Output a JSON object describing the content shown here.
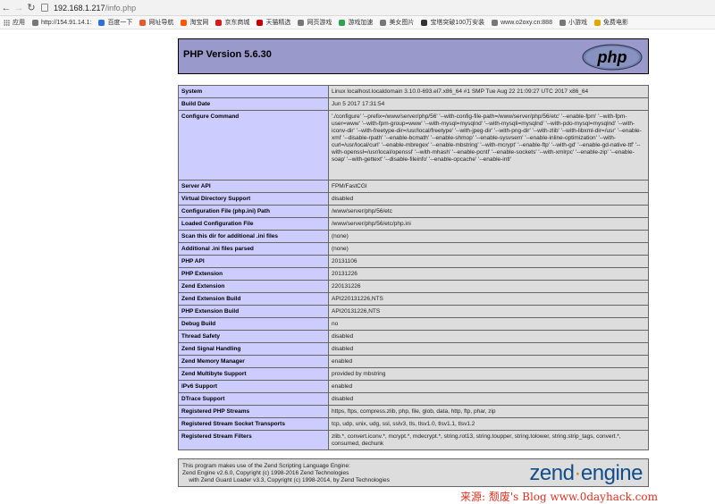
{
  "browser": {
    "url_host": "192.168.1.217",
    "url_path": "/info.php",
    "bookmarks": [
      {
        "label": "应用",
        "color": "#4a7bd6",
        "icon": "apps-icon"
      },
      {
        "label": "http://154.91.14.1:",
        "color": "#777777",
        "icon": "page-icon"
      },
      {
        "label": "百度一下",
        "color": "#2f6ee0",
        "icon": "baidu-icon"
      },
      {
        "label": "网址导航",
        "color": "#e55a2b",
        "icon": "nav-icon"
      },
      {
        "label": "淘宝网",
        "color": "#ff5500",
        "icon": "page-icon"
      },
      {
        "label": "京东商城",
        "color": "#d71a1a",
        "icon": "jd-icon"
      },
      {
        "label": "天猫精选",
        "color": "#c40000",
        "icon": "page-icon"
      },
      {
        "label": "网页游戏",
        "color": "#777777",
        "icon": "page-icon"
      },
      {
        "label": "游戏加速",
        "color": "#2da44e",
        "icon": "page-icon"
      },
      {
        "label": "美女图片",
        "color": "#777777",
        "icon": "page-icon"
      },
      {
        "label": "宝塔突破100万安装",
        "color": "#333333",
        "icon": "bt-icon"
      },
      {
        "label": "www.o2oxy.cn:888",
        "color": "#777777",
        "icon": "page-icon"
      },
      {
        "label": "小游戏",
        "color": "#777777",
        "icon": "page-icon"
      },
      {
        "label": "免费电影",
        "color": "#e0a800",
        "icon": "page-icon"
      }
    ]
  },
  "phpinfo": {
    "title": "PHP Version 5.6.30",
    "logo_text": "php",
    "rows": [
      {
        "key": "System",
        "value": "Linux localhost.localdomain 3.10.0-693.el7.x86_64 #1 SMP Tue Aug 22 21:09:27 UTC 2017 x86_64"
      },
      {
        "key": "Build Date",
        "value": "Jun 5 2017 17:31:54"
      },
      {
        "key": "Configure Command",
        "value": "'./configure' '--prefix=/www/server/php/56' '--with-config-file-path=/www/server/php/56/etc' '--enable-fpm' '--with-fpm-user=www' '--with-fpm-group=www' '--with-mysql=mysqlnd' '--with-mysqli=mysqlnd' '--with-pdo-mysql=mysqlnd' '--with-iconv-dir' '--with-freetype-dir=/usr/local/freetype' '--with-jpeg-dir' '--with-png-dir' '--with-zlib' '--with-libxml-dir=/usr' '--enable-xml' '--disable-rpath' '--enable-bcmath' '--enable-shmop' '--enable-sysvsem' '--enable-inline-optimization' '--with-curl=/usr/local/curl' '--enable-mbregex' '--enable-mbstring' '--with-mcrypt' '--enable-ftp' '--with-gd' '--enable-gd-native-ttf' '--with-openssl=/usr/local/openssl' '--with-mhash' '--enable-pcntl' '--enable-sockets' '--with-xmlrpc' '--enable-zip' '--enable-soap' '--with-gettext' '--disable-fileinfo' '--enable-opcache' '--enable-intl'"
      },
      {
        "key": "Server API",
        "value": "FPM/FastCGI"
      },
      {
        "key": "Virtual Directory Support",
        "value": "disabled"
      },
      {
        "key": "Configuration File (php.ini) Path",
        "value": "/www/server/php/56/etc"
      },
      {
        "key": "Loaded Configuration File",
        "value": "/www/server/php/56/etc/php.ini"
      },
      {
        "key": "Scan this dir for additional .ini files",
        "value": "(none)"
      },
      {
        "key": "Additional .ini files parsed",
        "value": "(none)"
      },
      {
        "key": "PHP API",
        "value": "20131106"
      },
      {
        "key": "PHP Extension",
        "value": "20131226"
      },
      {
        "key": "Zend Extension",
        "value": "220131226"
      },
      {
        "key": "Zend Extension Build",
        "value": "API220131226,NTS"
      },
      {
        "key": "PHP Extension Build",
        "value": "API20131226,NTS"
      },
      {
        "key": "Debug Build",
        "value": "no"
      },
      {
        "key": "Thread Safety",
        "value": "disabled"
      },
      {
        "key": "Zend Signal Handling",
        "value": "disabled"
      },
      {
        "key": "Zend Memory Manager",
        "value": "enabled"
      },
      {
        "key": "Zend Multibyte Support",
        "value": "provided by mbstring"
      },
      {
        "key": "IPv6 Support",
        "value": "enabled"
      },
      {
        "key": "DTrace Support",
        "value": "disabled"
      },
      {
        "key": "Registered PHP Streams",
        "value": "https, ftps, compress.zlib, php, file, glob, data, http, ftp, phar, zip"
      },
      {
        "key": "Registered Stream Socket Transports",
        "value": "tcp, udp, unix, udg, ssl, sslv3, tls, tlsv1.0, tlsv1.1, tlsv1.2"
      },
      {
        "key": "Registered Stream Filters",
        "value": "zlib.*, convert.iconv.*, mcrypt.*, mdecrypt.*, string.rot13, string.toupper, string.tolower, string.strip_tags, convert.*, consumed, dechunk"
      }
    ],
    "footer_lines": [
      "This program makes use of the Zend Scripting Language Engine:",
      "Zend Engine v2.6.0, Copyright (c) 1998-2016 Zend Technologies",
      "    with Zend Guard Loader v3.3, Copyright (c) 1998-2014, by Zend Technologies"
    ],
    "zend_logo_left": "zend",
    "zend_logo_dot": "·",
    "zend_logo_right": "engine"
  },
  "watermark": "来源: 颓废's Blog www.0dayhack.com",
  "colors": {
    "header_bg": "#9999cc",
    "key_bg": "#ccccff",
    "value_bg": "#dddddd"
  }
}
